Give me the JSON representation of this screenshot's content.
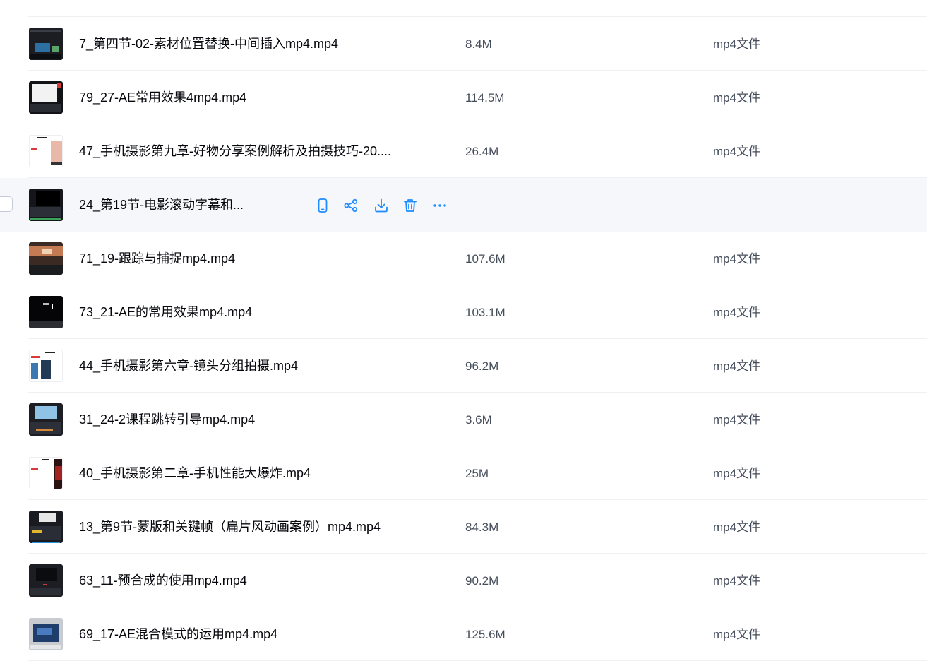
{
  "colors": {
    "accent": "#1f8cff",
    "row_hover": "#f5f7fb",
    "divider": "#eef0f4",
    "name_text": "#06070c",
    "meta_text": "#454d5a"
  },
  "row_actions": [
    {
      "icon": "phone-icon",
      "name": "send-to-phone-button"
    },
    {
      "icon": "share-icon",
      "name": "share-button"
    },
    {
      "icon": "download-icon",
      "name": "download-button"
    },
    {
      "icon": "trash-icon",
      "name": "delete-button"
    },
    {
      "icon": "more-icon",
      "name": "more-button"
    }
  ],
  "files": [
    {
      "name": "7_第四节-02-素材位置替换-中间插入mp4.mp4",
      "size": "8.4M",
      "type": "mp4文件",
      "thumbnail": "dark-editor"
    },
    {
      "name": "79_27-AE常用效果4mp4.mp4",
      "size": "114.5M",
      "type": "mp4文件",
      "thumbnail": "dark-white-panel"
    },
    {
      "name": "47_手机摄影第九章-好物分享案例解析及拍摄技巧-20....",
      "size": "26.4M",
      "type": "mp4文件",
      "thumbnail": "white-slide-pink"
    },
    {
      "name": "24_第19节-电影滚动字幕和...",
      "size": "",
      "type": "",
      "thumbnail": "dark-editor-2",
      "hovered": true
    },
    {
      "name": "71_19-跟踪与捕捉mp4.mp4",
      "size": "107.6M",
      "type": "mp4文件",
      "thumbnail": "warm-landscape"
    },
    {
      "name": "73_21-AE的常用效果mp4.mp4",
      "size": "103.1M",
      "type": "mp4文件",
      "thumbnail": "black-screen"
    },
    {
      "name": "44_手机摄影第六章-镜头分组拍摄.mp4",
      "size": "96.2M",
      "type": "mp4文件",
      "thumbnail": "white-slide-blue"
    },
    {
      "name": "31_24-2课程跳转引导mp4.mp4",
      "size": "3.6M",
      "type": "mp4文件",
      "thumbnail": "dark-editor-3"
    },
    {
      "name": "40_手机摄影第二章-手机性能大爆炸.mp4",
      "size": "25M",
      "type": "mp4文件",
      "thumbnail": "white-slide-red"
    },
    {
      "name": "13_第9节-蒙版和关键帧（扁片风动画案例）mp4.mp4",
      "size": "84.3M",
      "type": "mp4文件",
      "thumbnail": "dark-editor-4"
    },
    {
      "name": "63_11-预合成的使用mp4.mp4",
      "size": "90.2M",
      "type": "mp4文件",
      "thumbnail": "dark-editor-5"
    },
    {
      "name": "69_17-AE混合模式的运用mp4.mp4",
      "size": "125.6M",
      "type": "mp4文件",
      "thumbnail": "gray-blue-frame"
    }
  ]
}
